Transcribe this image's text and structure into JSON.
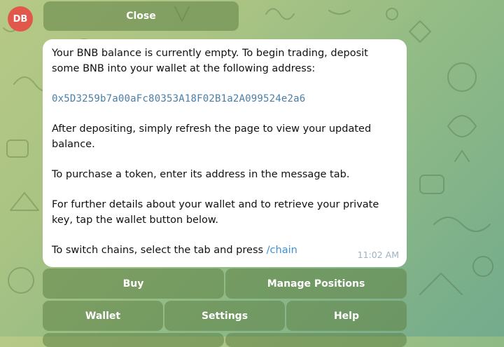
{
  "avatar": {
    "initials": "DB",
    "color": "#e2574c"
  },
  "keyboard": {
    "close_label": "Close",
    "buy_label": "Buy",
    "manage_positions_label": "Manage Positions",
    "wallet_label": "Wallet",
    "settings_label": "Settings",
    "help_label": "Help"
  },
  "message": {
    "para1": "Your BNB balance is currently empty. To begin trading, deposit some BNB into your wallet at the following address:",
    "address": "0x5D3259b7a00aFc80353A18F02B1a2A099524e2a6",
    "para2": "After depositing, simply refresh the page to view your updated balance.",
    "para3": "To purchase a token, enter its address in the message tab.",
    "para4": "For further details about your wallet and to retrieve your private key, tap the wallet button below.",
    "para5_prefix": "To switch chains, select the tab and press ",
    "para5_command": "/chain",
    "time": "11:02 AM"
  },
  "colors": {
    "link": "#3d8fd6",
    "address": "#4a7fa7",
    "button_bg": "#5f8246"
  }
}
